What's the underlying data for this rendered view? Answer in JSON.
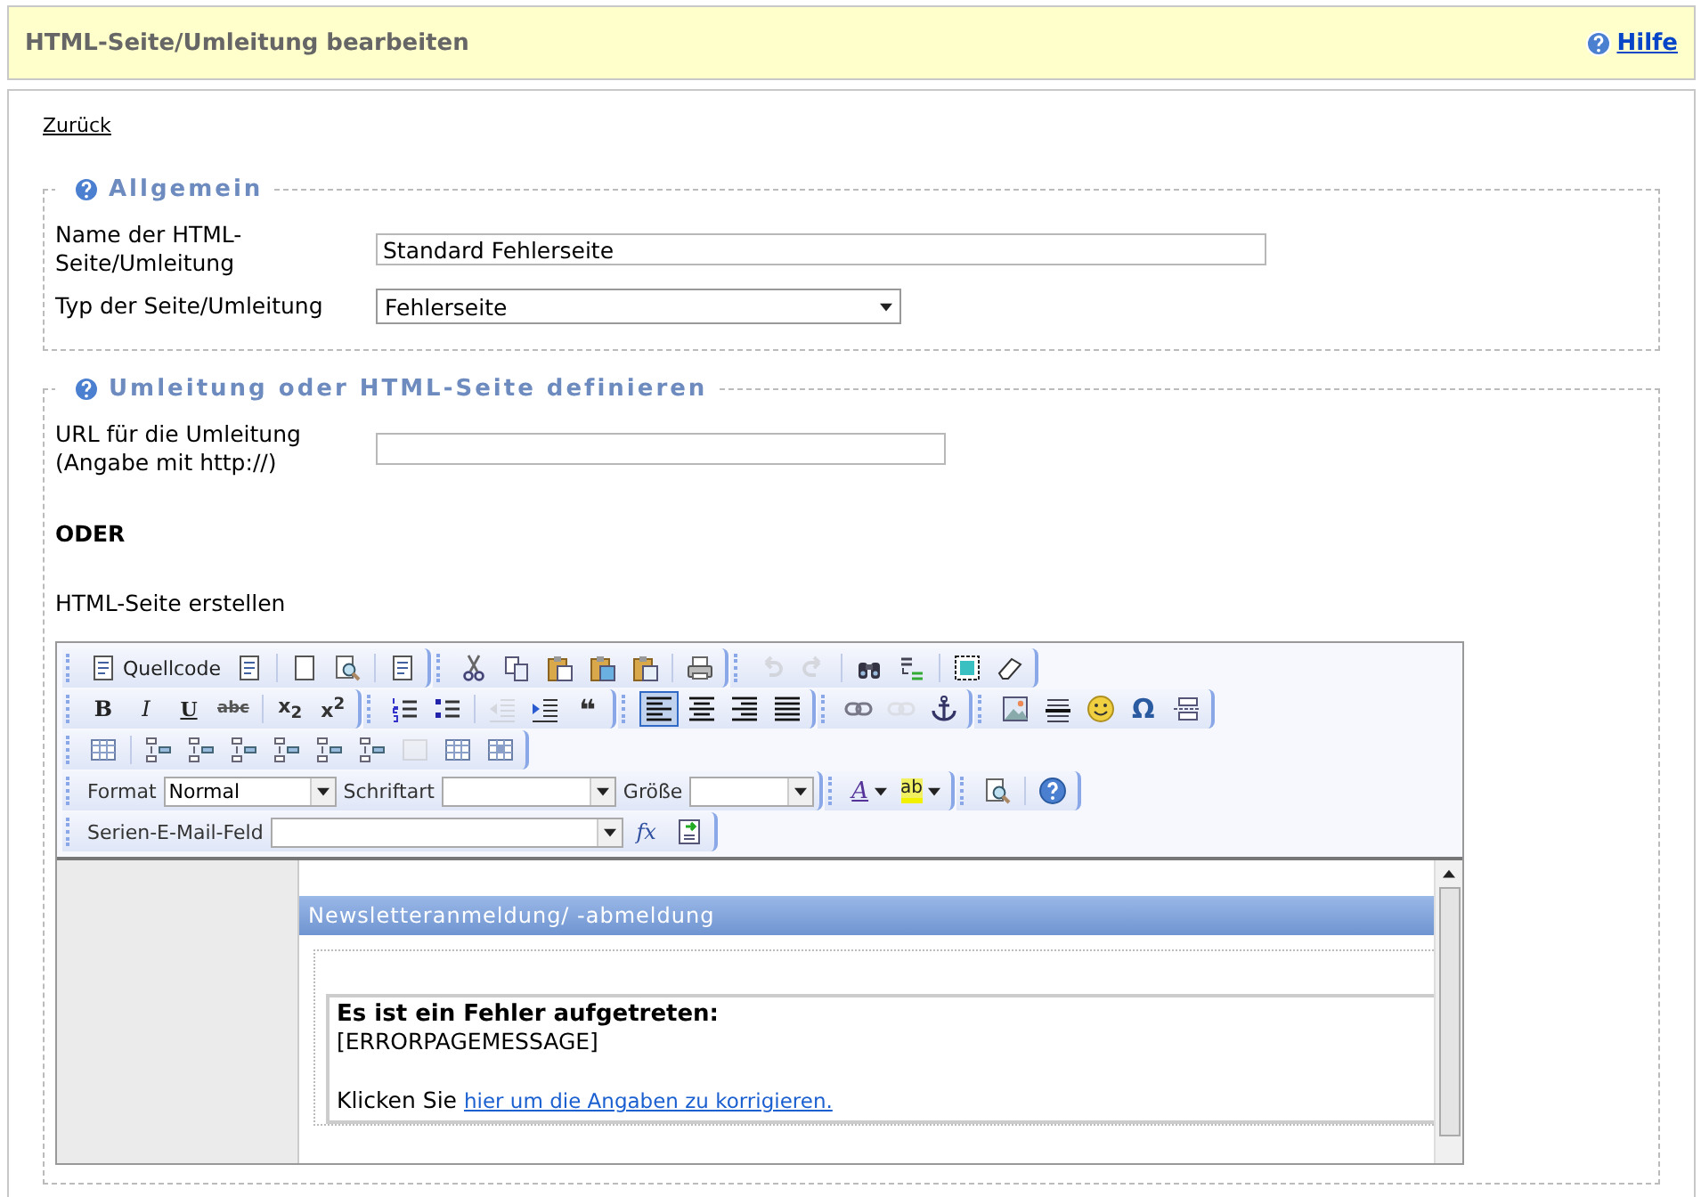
{
  "header": {
    "title": "HTML-Seite/Umleitung bearbeiten",
    "help_link": "Hilfe"
  },
  "back_link": "Zurück",
  "sections": [
    {
      "legend": "Allgemein",
      "fields": [
        {
          "kind": "text",
          "label": "Name der HTML-Seite/Umleitung",
          "value": "Standard Fehlerseite"
        },
        {
          "kind": "select",
          "label": "Typ der Seite/Umleitung",
          "value": "Fehlerseite"
        }
      ]
    },
    {
      "legend": "Umleitung oder HTML-Seite definieren",
      "fields": [
        {
          "kind": "text",
          "label": "URL für die Umleitung (Angabe mit http://)"
        }
      ],
      "or_label": "ODER",
      "html_label": "HTML-Seite erstellen"
    }
  ],
  "editor": {
    "toolbar_rows": [
      [
        [
          [
            {
              "kind": "source",
              "label": "Quellcode",
              "disabled": false,
              "on": false
            },
            {
              "kind": "docprops",
              "disabled": false,
              "on": false
            }
          ],
          [
            {
              "kind": "newpage",
              "disabled": false,
              "on": false
            },
            {
              "kind": "preview",
              "disabled": false,
              "on": false
            }
          ],
          [
            {
              "kind": "templates",
              "disabled": false,
              "on": false
            }
          ]
        ],
        [
          [
            {
              "kind": "cut",
              "disabled": false,
              "on": false
            },
            {
              "kind": "copy",
              "disabled": false,
              "on": false
            },
            {
              "kind": "paste",
              "disabled": false,
              "on": false
            },
            {
              "kind": "pastetext",
              "disabled": false,
              "on": false
            },
            {
              "kind": "pasteword",
              "disabled": false,
              "on": false
            }
          ],
          [
            {
              "kind": "print",
              "disabled": false,
              "on": false
            }
          ]
        ],
        [
          [
            {
              "kind": "undo",
              "disabled": true,
              "on": false
            },
            {
              "kind": "redo",
              "disabled": true,
              "on": false
            }
          ],
          [
            {
              "kind": "find",
              "disabled": false,
              "on": false
            },
            {
              "kind": "replace",
              "disabled": false,
              "on": false
            }
          ],
          [
            {
              "kind": "selectall",
              "disabled": false,
              "on": false
            },
            {
              "kind": "eraser",
              "disabled": false,
              "on": false
            }
          ]
        ]
      ],
      [
        [
          [
            {
              "kind": "bold",
              "label": "B",
              "disabled": false,
              "on": false
            },
            {
              "kind": "italic",
              "label": "I",
              "disabled": false,
              "on": false
            },
            {
              "kind": "underline",
              "label": "U",
              "disabled": false,
              "on": false
            },
            {
              "kind": "strike",
              "label": "abc",
              "disabled": false,
              "on": false
            }
          ],
          [
            {
              "kind": "sub",
              "label": "x$_{2}$",
              "disabled": false,
              "on": false
            },
            {
              "kind": "sup",
              "label": "x$^{2}$",
              "disabled": false,
              "on": false
            }
          ]
        ],
        [
          [
            {
              "kind": "ol",
              "disabled": false,
              "on": false
            },
            {
              "kind": "ul",
              "disabled": false,
              "on": false
            }
          ],
          [
            {
              "kind": "outdent",
              "disabled": true,
              "on": false
            },
            {
              "kind": "indent",
              "disabled": false,
              "on": false
            },
            {
              "kind": "quote",
              "label": "❝",
              "disabled": false,
              "on": false
            }
          ]
        ],
        [
          [
            {
              "kind": "alignleft",
              "disabled": false,
              "on": true
            },
            {
              "kind": "aligncenter",
              "disabled": false,
              "on": false
            },
            {
              "kind": "alignright",
              "disabled": false,
              "on": false
            },
            {
              "kind": "justify",
              "disabled": false,
              "on": false
            }
          ]
        ],
        [
          [
            {
              "kind": "link",
              "disabled": false,
              "on": false
            },
            {
              "kind": "unlink",
              "disabled": true,
              "on": false
            },
            {
              "kind": "anchor",
              "disabled": false,
              "on": false
            }
          ]
        ],
        [
          [
            {
              "kind": "image",
              "disabled": false,
              "on": false
            },
            {
              "kind": "hr",
              "disabled": false,
              "on": false
            },
            {
              "kind": "smiley",
              "disabled": false,
              "on": false
            },
            {
              "kind": "special",
              "label": "Ω",
              "disabled": false,
              "on": false
            },
            {
              "kind": "pagebreak",
              "disabled": false,
              "on": false
            }
          ]
        ]
      ],
      [
        [
          [
            {
              "kind": "table",
              "disabled": false,
              "on": false
            }
          ],
          [
            {
              "kind": "rowins",
              "disabled": false,
              "on": false
            },
            {
              "kind": "rowins",
              "disabled": false,
              "on": false
            },
            {
              "kind": "colins",
              "disabled": false,
              "on": false
            },
            {
              "kind": "colins",
              "disabled": false,
              "on": false
            },
            {
              "kind": "rowins",
              "disabled": false,
              "on": false
            },
            {
              "kind": "rowins",
              "disabled": false,
              "on": false
            },
            {
              "kind": "merge",
              "disabled": true,
              "on": false
            },
            {
              "kind": "grid",
              "disabled": false,
              "on": false
            },
            {
              "kind": "cellprops",
              "disabled": false,
              "on": false
            }
          ]
        ]
      ],
      [
        [
          [
            {
              "kind": "combo",
              "label": "Format",
              "value": "Normal"
            },
            {
              "kind": "combo",
              "label": "Schriftart"
            },
            {
              "kind": "combo",
              "label": "Größe"
            }
          ]
        ],
        [
          [
            {
              "kind": "textcolor",
              "label": "A",
              "disabled": false,
              "on": false
            },
            {
              "kind": "bgcolor",
              "label": "ab",
              "disabled": false,
              "on": false
            }
          ]
        ],
        [
          [
            {
              "kind": "preview",
              "disabled": false,
              "on": false
            }
          ],
          [
            {
              "kind": "help",
              "disabled": false,
              "on": false
            }
          ]
        ]
      ],
      [
        [
          [
            {
              "kind": "combo",
              "label": "Serien-E-Mail-Feld"
            },
            {
              "kind": "formula",
              "label": "fx",
              "disabled": false,
              "on": false
            },
            {
              "kind": "insertfield",
              "disabled": false,
              "on": false
            }
          ]
        ]
      ]
    ],
    "content": {
      "banner": "Newsletteranmeldung/ -abmeldung",
      "heading": "Es ist ein Fehler aufgetreten:",
      "message": "[ERRORPAGEMESSAGE]",
      "prompt": "Klicken Sie",
      "link": "hier um die Angaben zu korrigieren."
    }
  }
}
